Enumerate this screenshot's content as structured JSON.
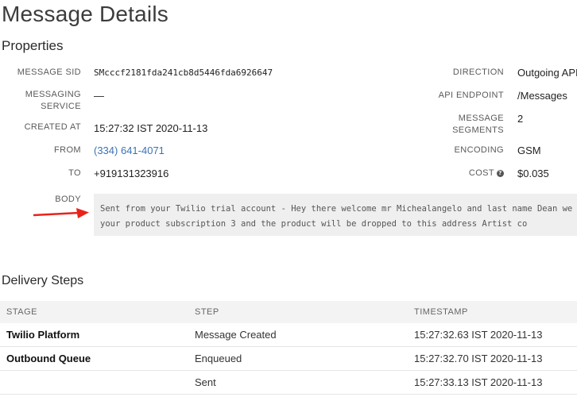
{
  "page_title": "Message Details",
  "properties": {
    "title": "Properties",
    "left": [
      {
        "label": "MESSAGE SID",
        "value": "SMcccf2181fda241cb8d5446fda6926647"
      },
      {
        "label_line1": "MESSAGING",
        "label_line2": "SERVICE",
        "value": "—"
      },
      {
        "label": "CREATED AT",
        "value": "15:27:32 IST 2020-11-13"
      },
      {
        "label": "FROM",
        "value": "(334) 641-4071"
      },
      {
        "label": "TO",
        "value": "+919131323916"
      }
    ],
    "right": [
      {
        "label": "DIRECTION",
        "value": "Outgoing API"
      },
      {
        "label": "API ENDPOINT",
        "value": "/Messages"
      },
      {
        "label_line1": "MESSAGE",
        "label_line2": "SEGMENTS",
        "value": "2"
      },
      {
        "label": "ENCODING",
        "value": "GSM"
      },
      {
        "label": "COST",
        "value": "$0.035",
        "icon": "info-icon"
      }
    ],
    "body": {
      "label": "BODY",
      "line1": "Sent from your Twilio trial account - Hey there welcome mr Michealangelo and last name Dean we are going",
      "line2": "your product subscription 3 and the product will be dropped to this address Artist co"
    }
  },
  "annotation": {
    "icon": "red-arrow",
    "color": "#e8231c"
  },
  "delivery": {
    "title": "Delivery Steps",
    "columns": [
      "STAGE",
      "STEP",
      "TIMESTAMP"
    ],
    "rows": [
      {
        "stage": "Twilio Platform",
        "step": "Message Created",
        "timestamp": "15:27:32.63 IST 2020-11-13"
      },
      {
        "stage": "Outbound Queue",
        "step": "Enqueued",
        "timestamp": "15:27:32.70 IST 2020-11-13"
      },
      {
        "stage": "",
        "step": "Sent",
        "timestamp": "15:27:33.13 IST 2020-11-13"
      }
    ]
  },
  "colors": {
    "link": "#3a73b5",
    "body_bg": "#efefef",
    "header_bg": "#f3f3f3"
  }
}
